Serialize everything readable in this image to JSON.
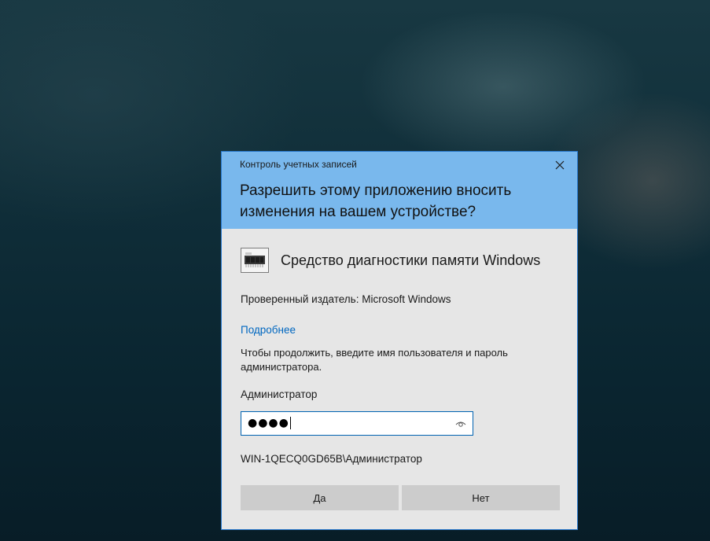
{
  "dialog": {
    "window_title": "Контроль учетных записей",
    "question": "Разрешить этому приложению вносить изменения на вашем устройстве?",
    "app_name": "Средство диагностики памяти Windows",
    "publisher": "Проверенный издатель: Microsoft Windows",
    "more_link": "Подробнее",
    "instruction": "Чтобы продолжить, введите имя пользователя и пароль администратора.",
    "user_label": "Администратор",
    "password_value": "●●●●",
    "domain_user": "WIN-1QECQ0GD65B\\Администратор",
    "yes_label": "Да",
    "no_label": "Нет",
    "icons": {
      "close": "close-icon",
      "app": "memory-chip-icon",
      "reveal": "eye-icon"
    }
  },
  "colors": {
    "header_bg": "#79b8ed",
    "dialog_bg": "#e6e6e6",
    "border": "#2b7bd0",
    "link": "#0067c0",
    "button_bg": "#cccccc"
  }
}
